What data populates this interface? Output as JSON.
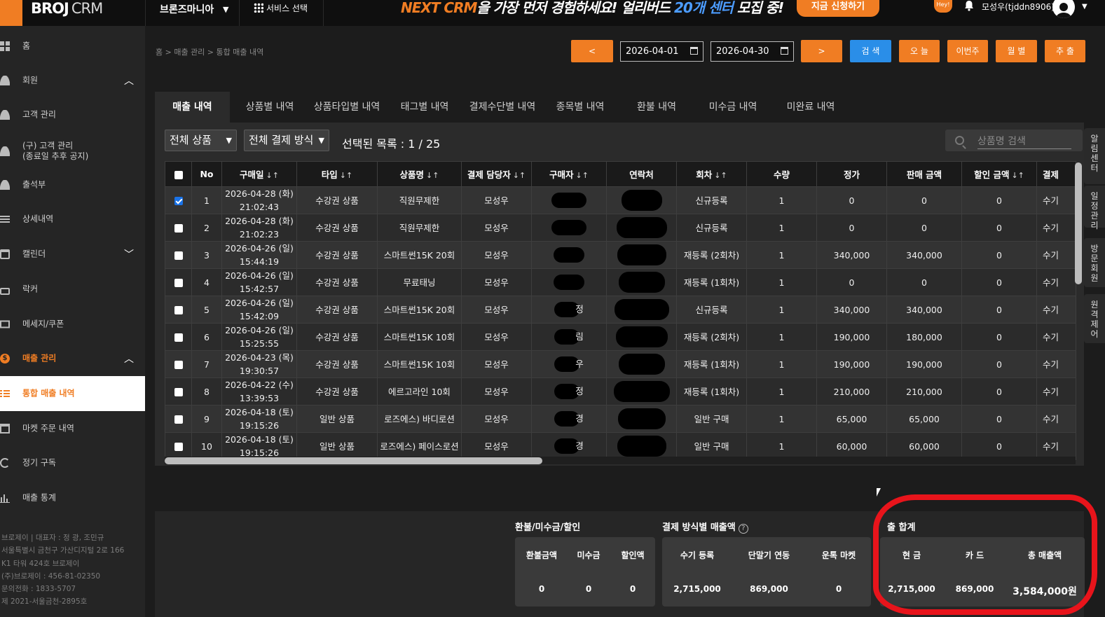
{
  "topbar": {
    "brand": "BROJ",
    "brand_suffix": "CRM",
    "store_name": "브론즈마니아",
    "service_select": "서비스 선택",
    "promo_part1": "NEXT CRM",
    "promo_part2": "을 가장 먼저 경험하세요! 얼리버드 ",
    "promo_part3": "20개 센터",
    "promo_part4": " 모집 중!",
    "promo_button": "지금 신청하기",
    "hey_badge": "Hey!",
    "user_name": "모성우(tjddn8906)"
  },
  "sidebar": {
    "items": [
      {
        "label": "홈"
      },
      {
        "label": "회원"
      },
      {
        "label": "고객 관리"
      },
      {
        "label": "(구) 고객 관리\n(종료일 추후 공지)"
      },
      {
        "label": "출석부"
      },
      {
        "label": "상세내역"
      },
      {
        "label": "캘린더"
      },
      {
        "label": "락커"
      },
      {
        "label": "메세지/쿠폰"
      },
      {
        "label": "매출 관리"
      },
      {
        "label": "통합 매출 내역"
      },
      {
        "label": "마켓 주문 내역"
      },
      {
        "label": "정기 구독"
      },
      {
        "label": "매출 통계"
      }
    ],
    "company_info": [
      "브로제이 | 대표자 : 정 광, 조민규",
      "서울특별시 금천구 가산디지털 2로 166",
      "K1 타워 424호 브로제이",
      "(주)브로제이 : 456-81-02350",
      "문의전화 : 1833-5707",
      "제 2021-서울금천-2895호"
    ]
  },
  "breadcrumb": "홈 > 매출 관리 > 통합 매출 내역",
  "controls": {
    "prev": "<",
    "next": ">",
    "start_date": "2026-04-01",
    "end_date": "2026-04-30",
    "search": "검 색",
    "today": "오 늘",
    "this_week": "이번주",
    "monthly": "월 별",
    "export": "추 출"
  },
  "tabs": [
    {
      "label": "매출 내역"
    },
    {
      "label": "상품별 내역"
    },
    {
      "label": "상품타입별 내역"
    },
    {
      "label": "태그별 내역"
    },
    {
      "label": "결제수단별 내역"
    },
    {
      "label": "종목별 내역"
    },
    {
      "label": "환불 내역"
    },
    {
      "label": "미수금 내역"
    },
    {
      "label": "미완료 내역"
    }
  ],
  "filters": {
    "product": "전체 상품",
    "payment": "전체 결제 방식",
    "selected_label": "선택된 목록 : 1 / 25",
    "search_placeholder": "상품명 검색"
  },
  "table": {
    "headers": [
      "No",
      "구매일",
      "타입",
      "상품명",
      "결제 담당자",
      "구매자",
      "연락처",
      "회차",
      "수량",
      "정가",
      "판매 금액",
      "할인 금액",
      "결제"
    ],
    "rows": [
      {
        "no": "1",
        "date": "2026-04-28 (화)",
        "time": "21:02:43",
        "type": "수강권 상품",
        "product": "직원무제한",
        "staff": "모성우",
        "buyer": "",
        "round": "신규등록",
        "qty": "1",
        "price": "0",
        "sale": "0",
        "discount": "0",
        "pay": "수기",
        "checked": true
      },
      {
        "no": "2",
        "date": "2026-04-28 (화)",
        "time": "21:02:23",
        "type": "수강권 상품",
        "product": "직원무제한",
        "staff": "모성우",
        "buyer": "",
        "round": "신규등록",
        "qty": "1",
        "price": "0",
        "sale": "0",
        "discount": "0",
        "pay": "수기",
        "checked": false
      },
      {
        "no": "3",
        "date": "2026-04-26 (일)",
        "time": "15:44:19",
        "type": "수강권 상품",
        "product": "스마트썬15K 20회",
        "staff": "모성우",
        "buyer": "",
        "round": "재등록 (2회차)",
        "qty": "1",
        "price": "340,000",
        "sale": "340,000",
        "discount": "0",
        "pay": "수기",
        "checked": false
      },
      {
        "no": "4",
        "date": "2026-04-26 (일)",
        "time": "15:42:57",
        "type": "수강권 상품",
        "product": "무료태닝",
        "staff": "모성우",
        "buyer": "",
        "round": "재등록 (1회차)",
        "qty": "1",
        "price": "0",
        "sale": "0",
        "discount": "0",
        "pay": "수기",
        "checked": false
      },
      {
        "no": "5",
        "date": "2026-04-26 (일)",
        "time": "15:42:09",
        "type": "수강권 상품",
        "product": "스마트썬15K 20회",
        "staff": "모성우",
        "buyer": "정",
        "round": "신규등록",
        "qty": "1",
        "price": "340,000",
        "sale": "340,000",
        "discount": "0",
        "pay": "수기",
        "checked": false
      },
      {
        "no": "6",
        "date": "2026-04-26 (일)",
        "time": "15:25:55",
        "type": "수강권 상품",
        "product": "스마트썬15K 10회",
        "staff": "모성우",
        "buyer": "림",
        "round": "재등록 (2회차)",
        "qty": "1",
        "price": "190,000",
        "sale": "180,000",
        "discount": "0",
        "pay": "수기",
        "checked": false
      },
      {
        "no": "7",
        "date": "2026-04-23 (목)",
        "time": "19:30:57",
        "type": "수강권 상품",
        "product": "스마트썬15K 10회",
        "staff": "모성우",
        "buyer": "우",
        "round": "재등록 (1회차)",
        "qty": "1",
        "price": "190,000",
        "sale": "190,000",
        "discount": "0",
        "pay": "수기",
        "checked": false
      },
      {
        "no": "8",
        "date": "2026-04-22 (수)",
        "time": "13:39:53",
        "type": "수강권 상품",
        "product": "에르고라인 10회",
        "staff": "모성우",
        "buyer": "정",
        "round": "재등록 (1회차)",
        "qty": "1",
        "price": "210,000",
        "sale": "210,000",
        "discount": "0",
        "pay": "수기",
        "checked": false
      },
      {
        "no": "9",
        "date": "2026-04-18 (토)",
        "time": "19:15:26",
        "type": "일반 상품",
        "product": "로즈에스) 바디로션",
        "staff": "모성우",
        "buyer": "경",
        "round": "일반 구매",
        "qty": "1",
        "price": "65,000",
        "sale": "65,000",
        "discount": "0",
        "pay": "수기",
        "checked": false
      },
      {
        "no": "10",
        "date": "2026-04-18 (토)",
        "time": "19:15:26",
        "type": "일반 상품",
        "product": "로즈에스) 페이스로션",
        "staff": "모성우",
        "buyer": "경",
        "round": "일반 구매",
        "qty": "1",
        "price": "60,000",
        "sale": "60,000",
        "discount": "0",
        "pay": "수기",
        "checked": false
      }
    ]
  },
  "right_rail": [
    "알림센터",
    "일정관리",
    "방문회원",
    "원격제어"
  ],
  "summary": {
    "refund_title": "환불/미수금/할인",
    "refund_cols": [
      {
        "label": "환불금액",
        "value": "0"
      },
      {
        "label": "미수금",
        "value": "0"
      },
      {
        "label": "할인액",
        "value": "0"
      }
    ],
    "payment_title": "결제 방식별 매출액",
    "payment_cols": [
      {
        "label": "수기 등록",
        "value": "2,715,000"
      },
      {
        "label": "단말기 연동",
        "value": "869,000"
      },
      {
        "label": "운톡 마켓",
        "value": "0"
      }
    ],
    "total_title": "출 합계",
    "total_cols": [
      {
        "label": "현 금",
        "value": "2,715,000"
      },
      {
        "label": "카 드",
        "value": "869,000"
      },
      {
        "label": "총 매출액",
        "value": "3,584,000원"
      }
    ]
  },
  "colors": {
    "accent": "#f07d23",
    "search_blue": "#2a8ee8",
    "annotation_red": "#e8141b"
  }
}
